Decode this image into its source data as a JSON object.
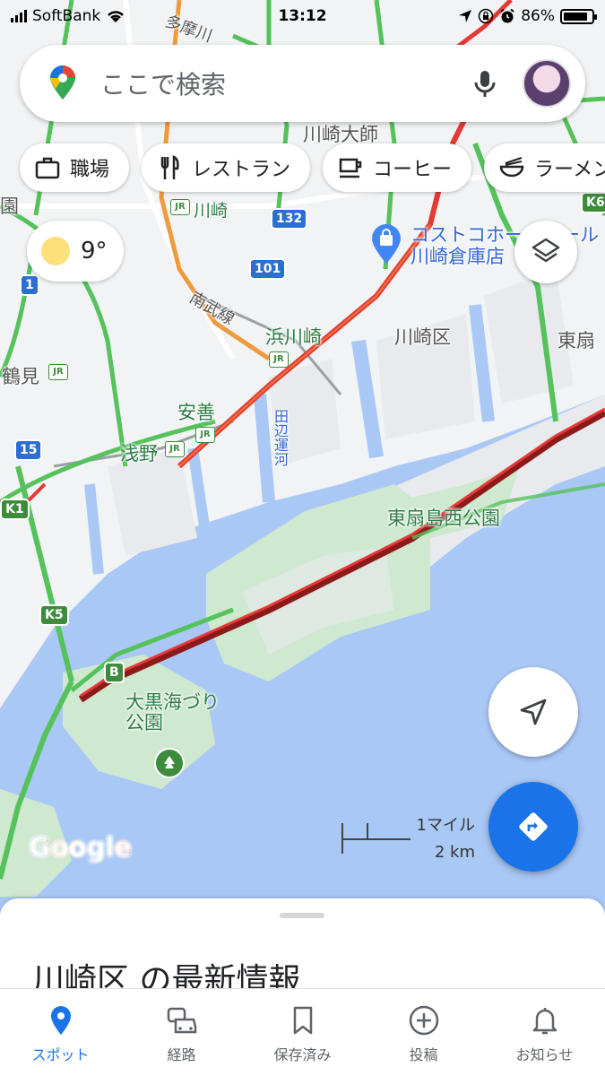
{
  "status_bar": {
    "carrier": "SoftBank",
    "time": "13:12",
    "battery": "86%",
    "battery_level": 0.86
  },
  "search": {
    "placeholder": "ここで検索"
  },
  "chips": [
    {
      "label": "職場",
      "icon": "briefcase-icon"
    },
    {
      "label": "レストラン",
      "icon": "restaurant-icon"
    },
    {
      "label": "コーヒー",
      "icon": "coffee-icon"
    },
    {
      "label": "ラーメン",
      "icon": "ramen-icon"
    }
  ],
  "weather": {
    "temperature": "9°",
    "icon": "sun-icon"
  },
  "map": {
    "labels": {
      "kawasaki_daishi": "川崎大師",
      "kawasaki": "川崎",
      "costco": "コストコホールセール 川崎倉庫店",
      "nambu_line": "南武線",
      "hama_kawasaki": "浜川崎",
      "kawasaki_ku": "川崎区",
      "higashi_ogi": "東扇",
      "tsurumi": "鶴見",
      "anzen": "安善",
      "asano": "浅野",
      "tanabe_canal": "田辺運河",
      "ogishima_park": "東扇島西公園",
      "daikoku_park": "大黒海づり公園",
      "en": "園",
      "tamagawa_top": "多摩川"
    },
    "shields": {
      "r132": "132",
      "r101": "101",
      "r1": "1",
      "r15": "15",
      "k5": "K5",
      "k1": "K1",
      "k6": "K6",
      "b": "B"
    },
    "scale_imperial": "1マイル",
    "scale_metric": "2 km",
    "logo": "Google"
  },
  "sheet": {
    "title": "川崎区 の最新情報"
  },
  "bottom_nav": [
    {
      "label": "スポット",
      "icon": "explore-pin-icon",
      "active": true
    },
    {
      "label": "経路",
      "icon": "car-icon",
      "active": false
    },
    {
      "label": "保存済み",
      "icon": "bookmark-icon",
      "active": false
    },
    {
      "label": "投稿",
      "icon": "add-circle-icon",
      "active": false
    },
    {
      "label": "お知らせ",
      "icon": "bell-icon",
      "active": false
    }
  ],
  "colors": {
    "accent": "#1a73e8",
    "water": "#aac8f6",
    "land": "#f1f3f4",
    "park": "#cfe8d0",
    "traffic_green": "#55c25b",
    "traffic_orange": "#f09a3e",
    "traffic_red": "#e53935",
    "traffic_dark_red": "#8b1a1a"
  }
}
